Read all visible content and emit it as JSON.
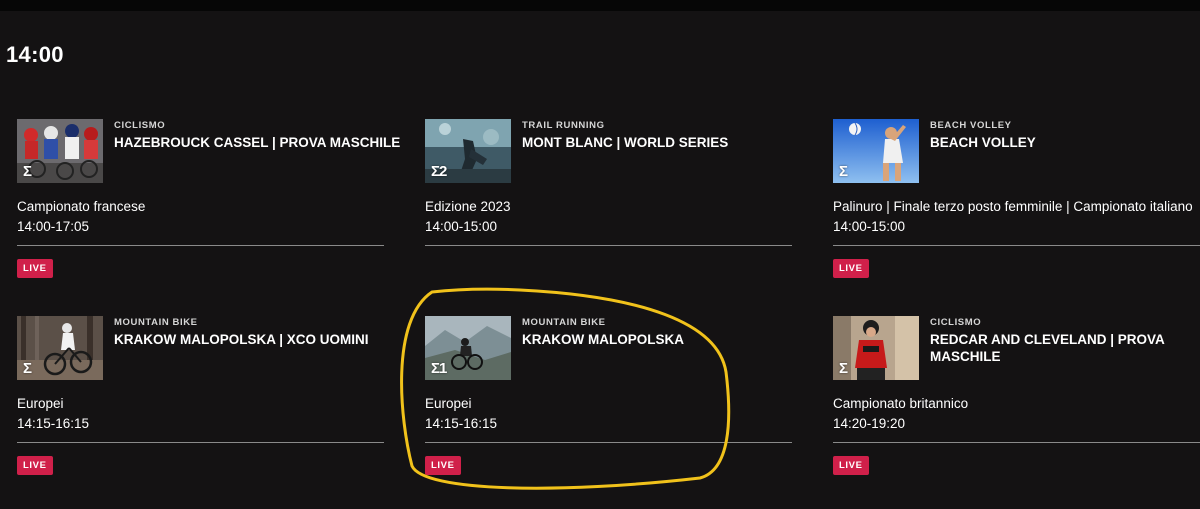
{
  "time_slot": "14:00",
  "cards": [
    {
      "sport": "CICLISMO",
      "title": "HAZEBROUCK CASSEL | PROVA MASCHILE",
      "subtitle": "Campionato francese",
      "time": "14:00-17:05",
      "badge": "LIVE",
      "channel": "Σ",
      "thumbnail_icon": "cycling-peloton-thumbnail"
    },
    {
      "sport": "TRAIL RUNNING",
      "title": "MONT BLANC | WORLD SERIES",
      "subtitle": "Edizione 2023",
      "time": "14:00-15:00",
      "badge": "",
      "channel": "Σ2",
      "thumbnail_icon": "trail-running-thumbnail"
    },
    {
      "sport": "BEACH VOLLEY",
      "title": "BEACH VOLLEY",
      "subtitle": "Palinuro | Finale terzo posto femminile | Campionato italiano",
      "time": "14:00-15:00",
      "badge": "LIVE",
      "channel": "Σ",
      "thumbnail_icon": "beach-volley-thumbnail"
    },
    {
      "sport": "MOUNTAIN BIKE",
      "title": "KRAKOW MALOPOLSKA | XCO UOMINI",
      "subtitle": "Europei",
      "time": "14:15-16:15",
      "badge": "LIVE",
      "channel": "Σ",
      "thumbnail_icon": "mountain-bike-forest-thumbnail"
    },
    {
      "sport": "MOUNTAIN BIKE",
      "title": "KRAKOW MALOPOLSKA",
      "subtitle": "Europei",
      "time": "14:15-16:15",
      "badge": "LIVE",
      "channel": "Σ1",
      "thumbnail_icon": "mountain-bike-valley-thumbnail"
    },
    {
      "sport": "CICLISMO",
      "title": "REDCAR AND CLEVELAND | PROVA MASCHILE",
      "subtitle": "Campionato britannico",
      "time": "14:20-19:20",
      "badge": "LIVE",
      "channel": "Σ",
      "thumbnail_icon": "cyclist-red-jersey-thumbnail"
    }
  ],
  "colors": {
    "background": "#141213",
    "live_badge": "#d0204a",
    "divider": "#8a8a8a",
    "highlight_annotation": "#f1c21b"
  }
}
